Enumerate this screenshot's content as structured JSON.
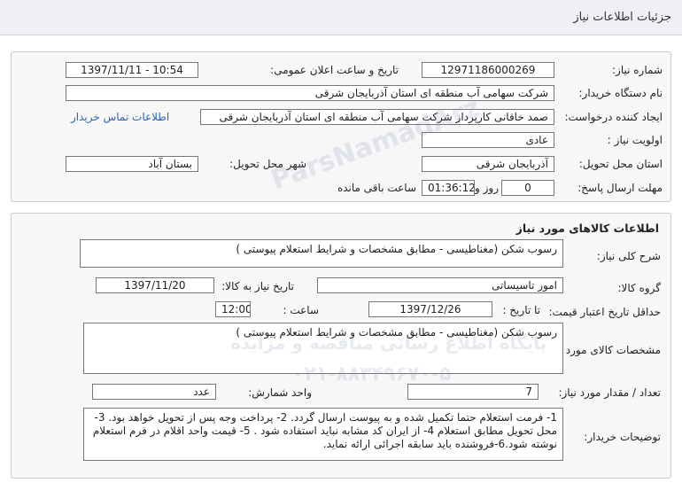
{
  "header": {
    "title": "جزئیات اطلاعات نیاز"
  },
  "info": {
    "need_number_label": "شماره نیاز:",
    "need_number": "12971186000269",
    "announce_label": "تاریخ و ساعت اعلان عمومی:",
    "announce_value": "1397/11/11 - 10:54",
    "buyer_label": "نام دستگاه خریدار:",
    "buyer_value": "شرکت سهامی آب منطقه ای استان آذربایجان شرقی",
    "creator_label": "ایجاد کننده درخواست:",
    "creator_value": "صمد خاقانی کارپرداز شرکت سهامی آب منطقه ای استان آذربایجان شرقی",
    "contact_link": "اطلاعات تماس خریدار",
    "priority_label": "اولویت نیاز :",
    "priority_value": "عادی",
    "province_label": "استان محل تحویل:",
    "province_value": "آذربایجان شرقی",
    "city_label": "شهر محل تحویل:",
    "city_value": "بستان آباد",
    "deadline_label": "مهلت ارسال پاسخ:",
    "days_value": "0",
    "days_label": "روز و",
    "time_value": "01:36:12",
    "remaining_label": "ساعت باقی مانده"
  },
  "goods": {
    "section_title": "اطلاعات کالاهای مورد نیاز",
    "general_desc_label": "شرح کلی نیاز:",
    "general_desc_value": "رسوب شکن (مغناطیسی - مطابق مشخصات و شرایط استعلام پیوستی )",
    "group_label": "گروه کالا:",
    "group_value": "امور تاسیساتی",
    "need_date_label": "تاریخ نیاز به کالا:",
    "need_date_value": "1397/11/20",
    "validity_label": "حداقل تاریخ اعتبار قیمت:",
    "until_date_label": "تا تاریخ :",
    "until_date_value": "1397/12/26",
    "hour_label": "ساعت :",
    "hour_value": "12:00",
    "spec_label": "مشخصات کالای مورد نیاز:",
    "spec_value": "رسوب شکن (مغناطیسی - مطابق مشخصات و شرایط استعلام پیوستی )",
    "qty_label": "تعداد / مقدار مورد نیاز:",
    "qty_value": "7",
    "unit_label": "واحد شمارش:",
    "unit_value": "عدد",
    "buyer_notes_label": "توضیحات خریدار:",
    "buyer_notes_value": "1-  فرمت استعلام حتما تکمیل شده و به پیوست ارسال گردد. 2- پرداخت وجه پس از تحویل خواهد بود. 3- محل تحویل مطابق استعلام 4- از ایران کد مشابه نباید استفاده شود . 5- قیمت واحد اقلام در فرم استعلام نوشته شود.6-فروشنده باید سابقه اجرائی ارائه نماید."
  },
  "watermark": {
    "line1": "ParsNamadArz",
    "line2": "پایگاه اطلاع رسانی مناقصه و مزایده",
    "line3": "۰۲۱-۸۸۳۴۹۶۷۰-۵"
  }
}
